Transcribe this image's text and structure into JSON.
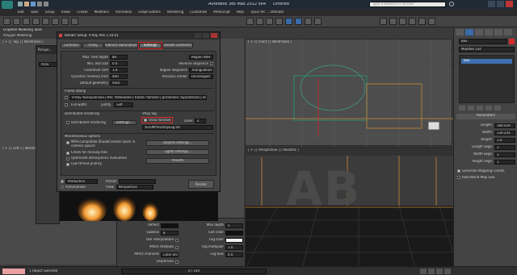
{
  "titlebar": {
    "app_title": "Autodesk 3ds Max  2012 x64",
    "doc_title": "Untitled",
    "search_placeholder": "Type a keyword or phrase"
  },
  "menubar": {
    "items": [
      "Edit",
      "Tools",
      "Group",
      "Views",
      "Create",
      "Modifiers",
      "Animation",
      "Graph Editors",
      "Rendering",
      "Customize",
      "MAXScript",
      "Help",
      "Tyson VR ... Ultimate"
    ]
  },
  "ribbon": {
    "tab": "Graphite Modeling Tools",
    "row2": "Polygon Modeling"
  },
  "viewports": {
    "top_left_label": "[ + ] [ Top ] [ Wireframe ]",
    "front_label": "[ + ] [ Left ] [ Wireframe ]",
    "perspective_label": "[ + ] [ Perspective ] [ Realistic ]",
    "top_right_label": "[ + ] [ Front ] [ Wireframe ]",
    "scene_text": "AB"
  },
  "render_frame": {
    "title": "Perspe...",
    "field": "Area"
  },
  "dialog": {
    "title": "Render Setup: V-Ray Adv 2.10.01",
    "tabs": [
      "Common",
      "V-Ray",
      "Indirect illumination",
      "Settings",
      "Render Elements"
    ],
    "active_tab": "Settings",
    "fields_left": [
      {
        "label": "Max. tree depth",
        "value": "80"
      },
      {
        "label": "Min. leaf size",
        "value": "0.0"
      },
      {
        "label": "Face/level coef",
        "value": "1.0"
      },
      {
        "label": "Dynamic memory limit",
        "value": "400"
      },
      {
        "label": "Default geometry",
        "value": "Auto"
      }
    ],
    "fields_right": [
      {
        "label": "Region sequence",
        "value": "Triangulation"
      },
      {
        "label": "Previous render",
        "value": "Unchanged"
      }
    ],
    "region_value": "Region W/H",
    "reverse_sequence": "Reverse sequence",
    "frame_stamp": "Frame stamp",
    "stamp_text": "V-Ray %vrayversion | file: %filename | frame: %frame | primitives: %primitives | render time: %rendertime",
    "full_width": "Full width",
    "justify_label": "Justify",
    "justify_value": "Left",
    "distributed_header": "Distributed rendering",
    "distributed_check": "Distributed rendering",
    "distributed_settings": "Settings...",
    "vraylog_header": "VRay log",
    "show_window": "Show window",
    "level_label": "Level",
    "level_value": "3",
    "log_path": "%TEMP%\\VRayLog.txt",
    "misc_header": "Miscellaneous options",
    "misc_options": [
      "MAX-compatible ShadeContext (work in camera space)",
      "Check for missing files",
      "Optimized atmospheric evaluation",
      "Low thread priority"
    ],
    "objects_settings": "Objects settings...",
    "lights_settings": "Lights settings...",
    "presets": "Presets",
    "footer_mode": "Production",
    "footer_preset_label": "Preset:",
    "footer_view_label": "ActiveShade",
    "footer_view_label2": "View:",
    "footer_view_value": "Perspective",
    "footer_render": "Render"
  },
  "cmd_panel": {
    "object_name": "Box",
    "modifier_list": "Modifier List",
    "stack_item": "Box",
    "params_header": "Parameters",
    "params": [
      {
        "label": "Length:",
        "value": "189.429"
      },
      {
        "label": "Width:",
        "value": "139.243"
      },
      {
        "label": "Height:",
        "value": "1.0"
      },
      {
        "label": "Length Segs:",
        "value": "1"
      },
      {
        "label": "Width Segs:",
        "value": "1"
      },
      {
        "label": "Height Segs:",
        "value": "1"
      }
    ],
    "gen_mapping": "Generate Mapping Coords.",
    "real_world": "Real-World Map Size"
  },
  "material_panel": {
    "rows": [
      {
        "label": "Reflect",
        "value": ""
      },
      {
        "label": "Subdivs",
        "value": "8"
      },
      {
        "label": "Use interpolation",
        "value": ""
      },
      {
        "label": "Affect shadows",
        "value": ""
      },
      {
        "label": "Affect channels",
        "value": "Color only"
      },
      {
        "label": "Dispersion",
        "value": ""
      }
    ],
    "right_rows": [
      {
        "label": "Max depth",
        "value": "5"
      },
      {
        "label": "Exit color",
        "value": ""
      },
      {
        "label": "Fog color",
        "value": ""
      },
      {
        "label": "Fog multiplier",
        "value": "1.0"
      },
      {
        "label": "Fog bias",
        "value": "0.0"
      }
    ]
  },
  "statusbar": {
    "selection": "1 Object Selected",
    "frame": "0 / 100"
  },
  "colors": {
    "accent_red": "#d82a2a",
    "floor_orange": "#c88a3a",
    "ui_gray": "#3b3b3b"
  }
}
